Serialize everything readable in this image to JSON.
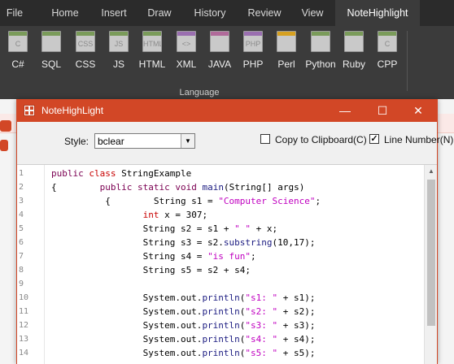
{
  "ribbon": {
    "tabs": [
      {
        "label": "File"
      },
      {
        "label": "Home"
      },
      {
        "label": "Insert"
      },
      {
        "label": "Draw"
      },
      {
        "label": "History"
      },
      {
        "label": "Review"
      },
      {
        "label": "View"
      },
      {
        "label": "NoteHighlight"
      }
    ],
    "active_tab": "NoteHighlight",
    "buttons": [
      {
        "label": "C#",
        "icon": "csharp-file-icon",
        "mark": "C",
        "band": "#7a9b5a"
      },
      {
        "label": "SQL",
        "icon": "sql-file-icon",
        "mark": "",
        "band": "#7a9b5a"
      },
      {
        "label": "CSS",
        "icon": "css-file-icon",
        "mark": "CSS",
        "band": "#7a9b5a"
      },
      {
        "label": "JS",
        "icon": "js-file-icon",
        "mark": "JS",
        "band": "#7a9b5a"
      },
      {
        "label": "HTML",
        "icon": "html-file-icon",
        "mark": "HTML",
        "band": "#7a9b5a"
      },
      {
        "label": "XML",
        "icon": "xml-file-icon",
        "mark": "<>",
        "band": "#9a6fb0"
      },
      {
        "label": "JAVA",
        "icon": "java-file-icon",
        "mark": "",
        "band": "#b06a9a"
      },
      {
        "label": "PHP",
        "icon": "php-file-icon",
        "mark": "PHP",
        "band": "#9a6fb0"
      },
      {
        "label": "Perl",
        "icon": "perl-file-icon",
        "mark": "",
        "band": "#d6a020"
      },
      {
        "label": "Python",
        "icon": "python-file-icon",
        "mark": "",
        "band": "#7a9b5a"
      },
      {
        "label": "Ruby",
        "icon": "ruby-file-icon",
        "mark": "",
        "band": "#7a9b5a"
      },
      {
        "label": "CPP",
        "icon": "cpp-file-icon",
        "mark": "C",
        "band": "#7a9b5a"
      }
    ],
    "group_label": "Language"
  },
  "dialog": {
    "title": "NoteHighLight",
    "minimize_glyph": "—",
    "maximize_glyph": "☐",
    "close_glyph": "✕",
    "style_label": "Style:",
    "style_value": "bclear",
    "clipboard_label": "Copy to Clipboard(C)",
    "clipboard_checked": false,
    "linenumber_label": "Line Number(N)",
    "linenumber_checked": true,
    "accent": "#d24726"
  },
  "code": {
    "line_numbers": [
      "1",
      "2",
      "3",
      "4",
      "5",
      "6",
      "7",
      "8",
      "9",
      "10",
      "11",
      "12",
      "13",
      "14"
    ],
    "lines": [
      "public class StringExample",
      "{        public static void main(String[] args)",
      "          {        String s1 = \"Computer Science\";",
      "                 int x = 307;",
      "                 String s2 = s1 + \" \" + x;",
      "                 String s3 = s2.substring(10,17);",
      "                 String s4 = \"is fun\";",
      "                 String s5 = s2 + s4;",
      "",
      "                 System.out.println(\"s1: \" + s1);",
      "                 System.out.println(\"s2: \" + s2);",
      "                 System.out.println(\"s3: \" + s3);",
      "                 System.out.println(\"s4: \" + s4);",
      "                 System.out.println(\"s5: \" + s5);"
    ]
  }
}
